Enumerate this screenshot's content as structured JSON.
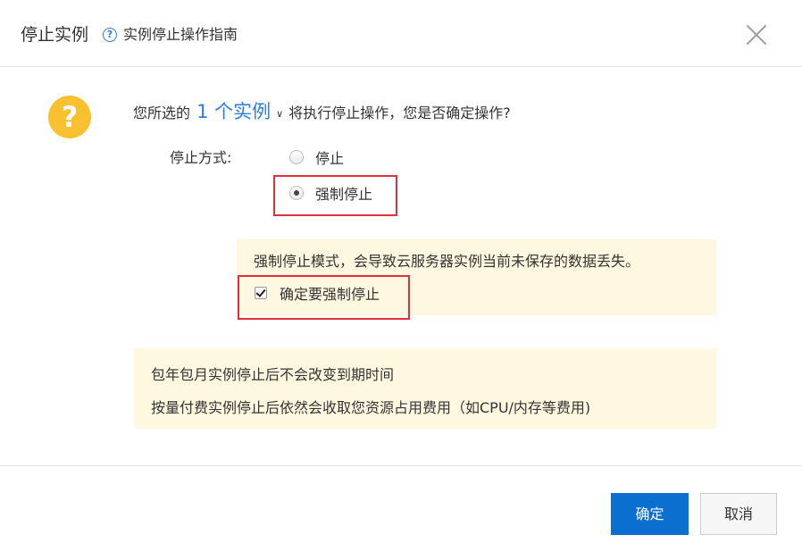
{
  "header": {
    "title": "停止实例",
    "help_icon": "?",
    "help_link": "实例停止操作指南",
    "close_icon": "close-icon"
  },
  "body": {
    "question_icon": "?",
    "prompt_prefix": "您所选的",
    "instance_count": "1 个实例",
    "prompt_chevron": "chevron-down-icon",
    "prompt_suffix": "将执行停止操作，您是否确定操作?",
    "method_label": "停止方式:",
    "radio_options": [
      {
        "label": "停止",
        "checked": false
      },
      {
        "label": "强制停止",
        "checked": true
      }
    ],
    "warning_text": "强制停止模式，会导致云服务器实例当前未保存的数据丢失。",
    "confirm_checkbox": {
      "label": "确定要强制停止",
      "checked": true
    },
    "info_lines": [
      "包年包月实例停止后不会改变到期时间",
      "按量付费实例停止后依然会收取您资源占用费用（如CPU/内存等费用)"
    ]
  },
  "footer": {
    "confirm_label": "确定",
    "cancel_label": "取消"
  },
  "colors": {
    "accent": "#0a6fcf",
    "link": "#2c7de0",
    "warning_bg": "#fff8e1",
    "question_icon": "#f9c130",
    "highlight_box": "#e0303a"
  }
}
